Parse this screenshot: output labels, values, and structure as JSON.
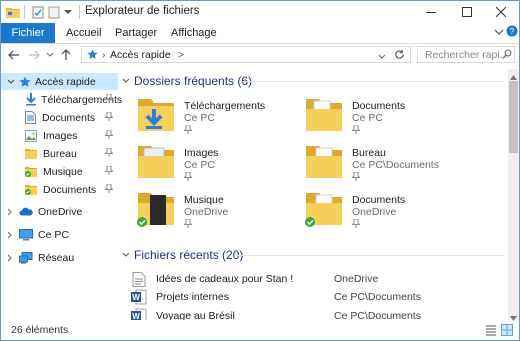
{
  "window": {
    "title": "Explorateur de fichiers"
  },
  "ribbon": {
    "tabs": [
      "Fichier",
      "Accueil",
      "Partager",
      "Affichage"
    ]
  },
  "address": {
    "path": "Accès rapide",
    "separator": ">"
  },
  "search": {
    "placeholder": "Rechercher rapi..."
  },
  "sidebar": {
    "quick_access": "Accès rapide",
    "pinned": [
      {
        "label": "Téléchargements",
        "icon": "download-folder-icon"
      },
      {
        "label": "Documents",
        "icon": "documents-icon"
      },
      {
        "label": "Images",
        "icon": "images-icon"
      },
      {
        "label": "Bureau",
        "icon": "folder-icon"
      },
      {
        "label": "Musique",
        "icon": "music-folder-icon"
      },
      {
        "label": "Documents",
        "icon": "folder-icon"
      }
    ],
    "onedrive": "OneDrive",
    "this_pc": "Ce PC",
    "network": "Réseau"
  },
  "frequent": {
    "title": "Dossiers fréquents (6)",
    "items": [
      {
        "name": "Téléchargements",
        "location": "Ce PC"
      },
      {
        "name": "Documents",
        "location": "Ce PC"
      },
      {
        "name": "Images",
        "location": "Ce PC"
      },
      {
        "name": "Bureau",
        "location": "Ce PC\\Documents"
      },
      {
        "name": "Musique",
        "location": "OneDrive"
      },
      {
        "name": "Documents",
        "location": "OneDrive"
      }
    ]
  },
  "recent": {
    "title": "Fichiers récents (20)",
    "items": [
      {
        "name": "Idées de cadeaux pour Stan !",
        "path": "OneDrive"
      },
      {
        "name": "Projets internes",
        "path": "Ce PC\\Documents"
      },
      {
        "name": "Voyage au Brésil",
        "path": "Ce PC\\Documents"
      }
    ]
  },
  "status": {
    "count": "26 éléments"
  },
  "colors": {
    "accent": "#1979ca",
    "selection": "#cce8ff",
    "group_title": "#1e3287",
    "folder": "#f0c24f",
    "sync_green": "#3aa935"
  }
}
